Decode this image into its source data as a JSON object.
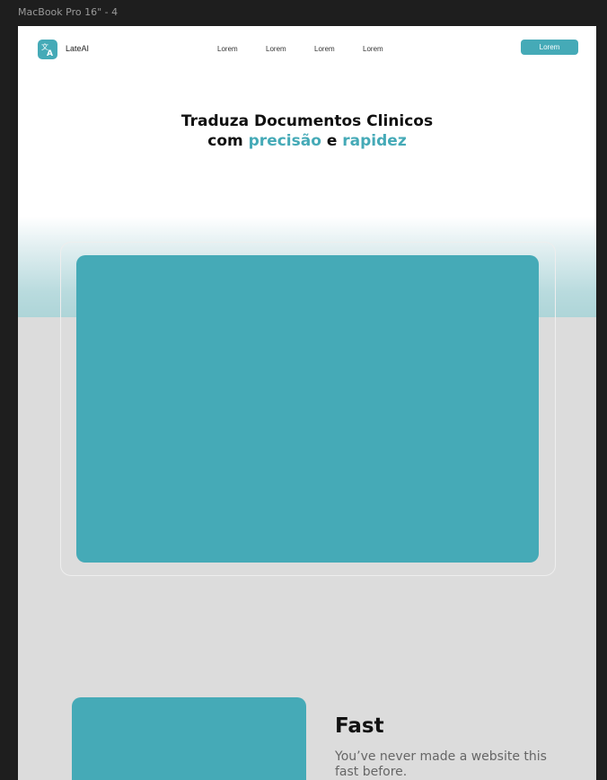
{
  "editor": {
    "frame_label": "MacBook Pro 16\" - 4"
  },
  "brand": {
    "name": "LateAI",
    "logo_icon": "translate-icon",
    "accent_color": "#45aab7"
  },
  "nav": {
    "links": [
      "Lorem",
      "Lorem",
      "Lorem",
      "Lorem"
    ],
    "cta_label": "Lorem"
  },
  "hero": {
    "line1": "Traduza Documentos Clinicos",
    "line2_prefix": "com ",
    "accent_word_1": "precisão",
    "connector": " e ",
    "accent_word_2": "rapidez"
  },
  "feature": {
    "title": "Fast",
    "description": "You’ve never made a website this fast before."
  }
}
